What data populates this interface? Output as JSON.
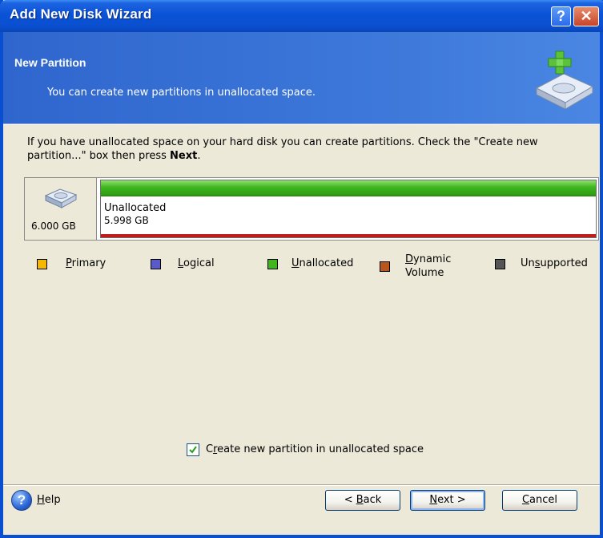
{
  "window": {
    "title": "Add New Disk Wizard",
    "help_button": "?",
    "close_button": "✕"
  },
  "header": {
    "title": "New Partition",
    "subtitle": "You can create new partitions in unallocated space."
  },
  "description": {
    "text_before": "If you have unallocated space on your hard disk you can create partitions. Check the \"Create new partition...\" box then press ",
    "emphasis": "Next",
    "text_after": "."
  },
  "disk": {
    "size": "6.000 GB",
    "partition": {
      "name": "Unallocated",
      "size": "5.998 GB"
    }
  },
  "legend": [
    {
      "key": "P",
      "rest": "rimary",
      "color": "#F5B800"
    },
    {
      "key": "L",
      "rest": "ogical",
      "color": "#5A5AC8"
    },
    {
      "key": "U",
      "rest": "nallocated",
      "color": "#3FB61E"
    },
    {
      "key": "D",
      "rest": "ynamic",
      "line2": "Volume",
      "color": "#B8561E"
    },
    {
      "prefix": "Un",
      "key": "s",
      "rest": "upported",
      "color": "#555555"
    }
  ],
  "checkbox": {
    "checked": true,
    "key": "r",
    "label_prefix": "C",
    "label_rest": "eate new partition in unallocated space"
  },
  "footer": {
    "help": {
      "key": "H",
      "rest": "elp"
    },
    "back": {
      "prefix": "< ",
      "key": "B",
      "rest": "ack"
    },
    "next": {
      "key": "N",
      "rest": "ext >"
    },
    "cancel": {
      "key": "C",
      "rest": "ancel"
    }
  }
}
